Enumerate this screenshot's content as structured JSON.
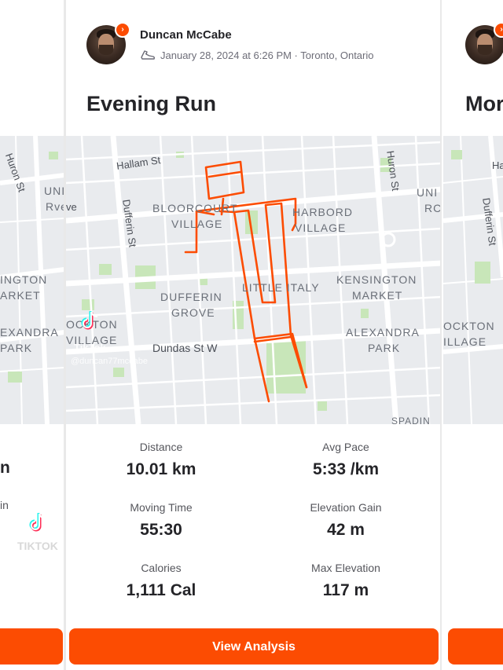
{
  "post": {
    "athlete_name": "Duncan McCabe",
    "date_location": "January 28, 2024 at 6:26 PM · Toronto, Ontario",
    "title": "Evening Run"
  },
  "map": {
    "neighborhoods": [
      "BLOORCOURT",
      "VILLAGE",
      "HARBORD",
      "VILLAGE",
      "LITTLE ITALY",
      "KENSINGTON",
      "MARKET",
      "DUFFERIN",
      "GROVE",
      "ALEXANDRA",
      "PARK",
      "OCKTON",
      "VILLAGE",
      "UNI",
      "RC",
      "SPADIN"
    ],
    "streets": [
      "Hallam St",
      "Dufferin St",
      "Huron St",
      "Dundas St W",
      "ve"
    ],
    "watermark_brand": "TikTok",
    "watermark_handle": "@duncan77mccabe",
    "route_color": "#fc4c02"
  },
  "stats": [
    {
      "label": "Distance",
      "value": "10.01 km"
    },
    {
      "label": "Avg Pace",
      "value": "5:33 /km"
    },
    {
      "label": "Moving Time",
      "value": "55:30"
    },
    {
      "label": "Elevation Gain",
      "value": "42 m"
    },
    {
      "label": "Calories",
      "value": "1,111 Cal"
    },
    {
      "label": "Max Elevation",
      "value": "117 m"
    }
  ],
  "cta_label": "View Analysis",
  "left_peek": {
    "map_labels": [
      "Huron St",
      "UNI",
      "Rve",
      "INGTON",
      "ARKET",
      "EXANDRA",
      "PARK"
    ],
    "stat_fragment": "n",
    "label_fragment": "in",
    "watermark_brand": "TIKTOK"
  },
  "right_peek": {
    "title_fragment": "Mor",
    "map_labels": [
      "Ha",
      "Dufferin St",
      "OCKTON",
      "ILLAGE"
    ]
  },
  "colors": {
    "accent": "#fc4c02",
    "map_bg": "#e9ebee",
    "park": "#c8e6b9"
  }
}
